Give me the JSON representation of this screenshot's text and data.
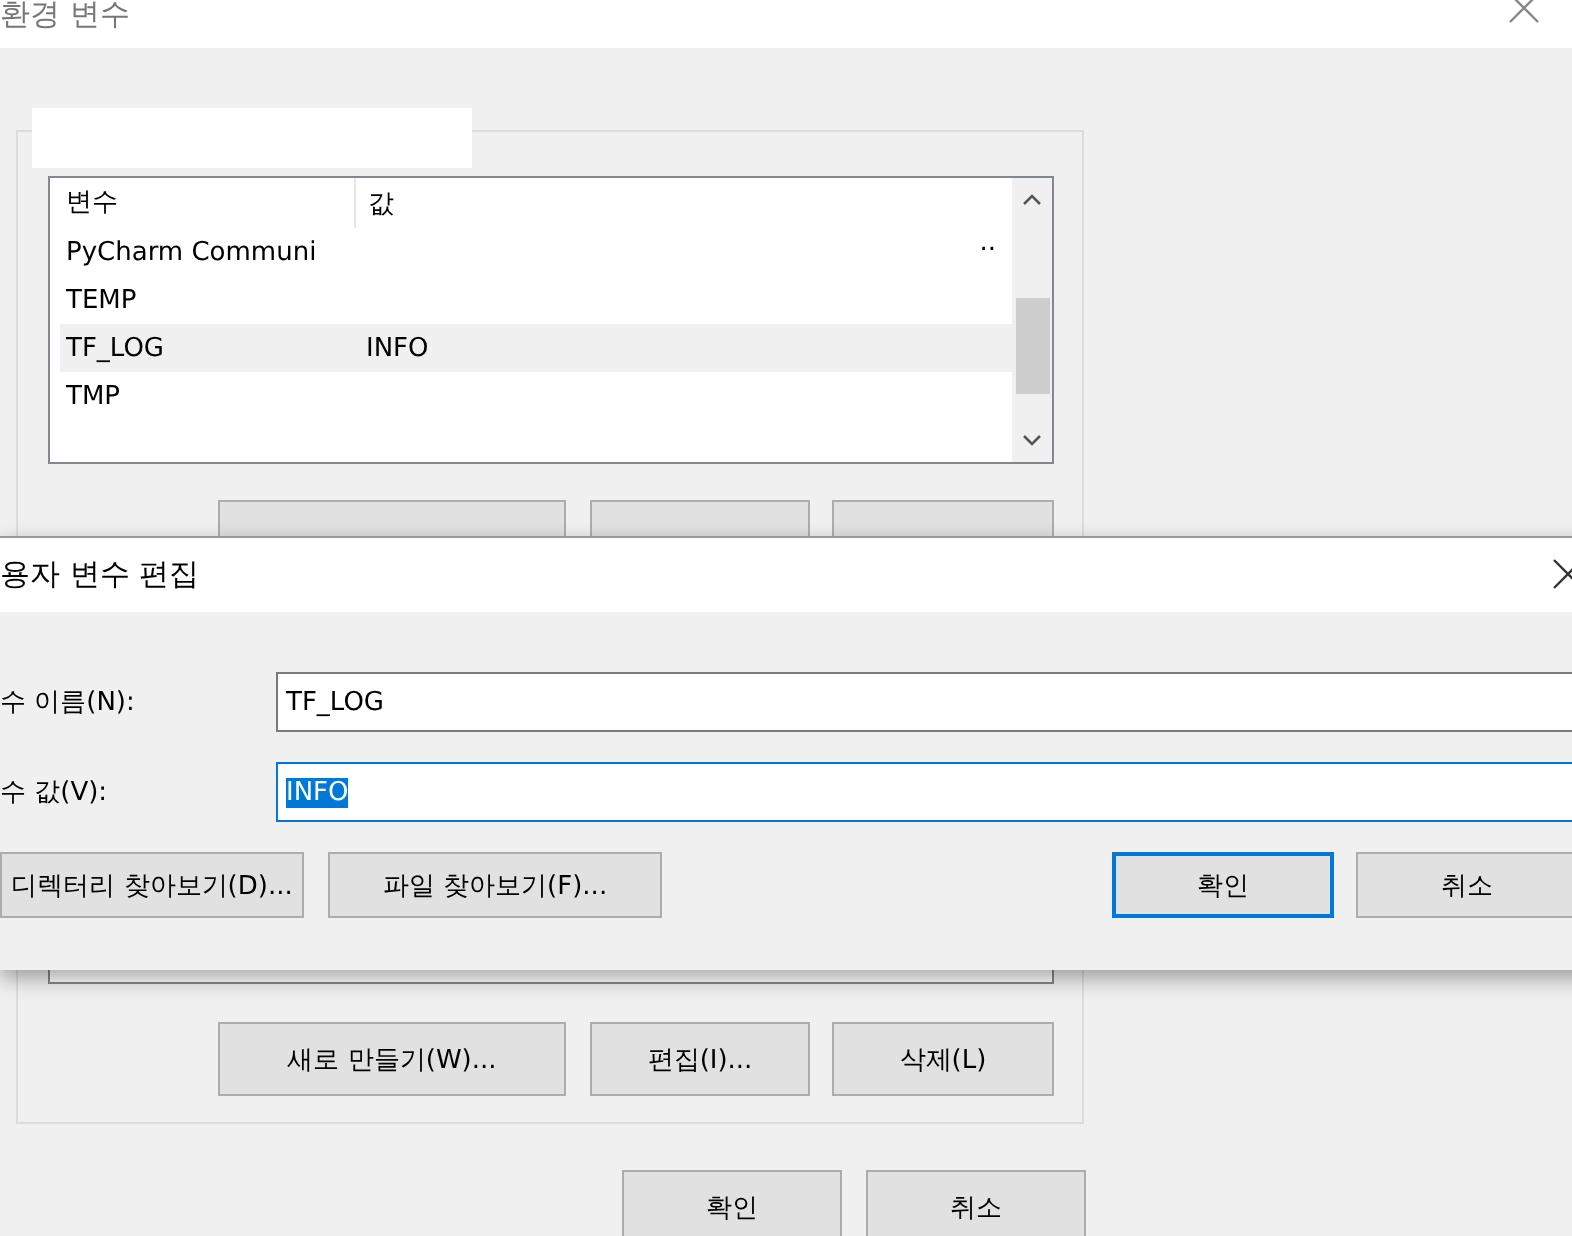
{
  "main_window": {
    "title": "환경 변수",
    "user_variables": {
      "columns": [
        "변수",
        "값"
      ],
      "rows": [
        {
          "name": "PyCharm Communi",
          "value": "..",
          "selected": false
        },
        {
          "name": "TEMP",
          "value": "",
          "selected": false
        },
        {
          "name": "TF_LOG",
          "value": "INFO",
          "selected": true
        },
        {
          "name": "TMP",
          "value": "",
          "selected": false
        }
      ]
    },
    "system_buttons": [
      "새로 만들기(W)...",
      "편집(I)...",
      "삭제(L)"
    ],
    "buttons": [
      "확인",
      "취소"
    ]
  },
  "edit_dialog": {
    "title": "용자 변수 편집",
    "fields": [
      {
        "label": "수 이름(N):",
        "value": "TF_LOG",
        "focused": false
      },
      {
        "label": "수 값(V):",
        "value": "INFO",
        "focused": true
      }
    ],
    "browse_buttons": [
      "디렉터리 찾아보기(D)...",
      "파일 찾아보기(F)..."
    ],
    "buttons": [
      {
        "label": "확인",
        "default": true
      },
      {
        "label": "취소",
        "default": false
      }
    ]
  }
}
